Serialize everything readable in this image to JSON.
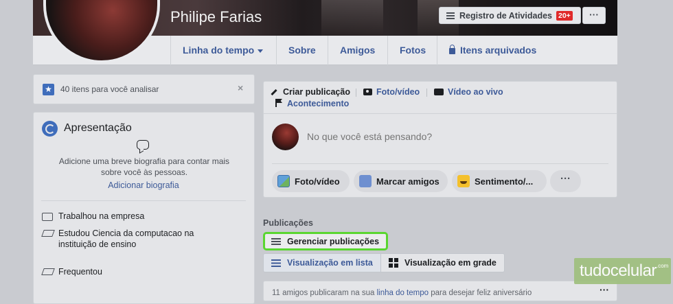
{
  "profile": {
    "name": "Philipe Farias",
    "activity_label": "Registro de Atividades",
    "activity_badge": "20+",
    "more_label": "···"
  },
  "nav": {
    "timeline": "Linha do tempo",
    "about": "Sobre",
    "friends": "Amigos",
    "photos": "Fotos",
    "archived": "Itens arquivados"
  },
  "notice": {
    "text": "40 itens para você analisar",
    "close": "×"
  },
  "intro": {
    "title": "Apresentação",
    "bio_prompt": "Adicione uma breve biografia para contar mais sobre você às pessoas.",
    "bio_link": "Adicionar biografia",
    "items": [
      "Trabalhou na empresa",
      "Estudou Ciencia da computacao na instituição de ensino",
      "Frequentou"
    ]
  },
  "composer": {
    "tabs": {
      "create": "Criar publicação",
      "photo_video": "Foto/vídeo",
      "live": "Vídeo ao vivo",
      "event": "Acontecimento"
    },
    "placeholder": "No que você está pensando?",
    "actions": {
      "photo": "Foto/vídeo",
      "tag": "Marcar amigos",
      "feeling": "Sentimento/...",
      "more": "···"
    }
  },
  "posts": {
    "label": "Publicações",
    "manage": "Gerenciar publicações",
    "list_view": "Visualização em lista",
    "grid_view": "Visualização em grade"
  },
  "feed": {
    "text_before": "11 amigos publicaram na sua ",
    "link": "linha do tempo",
    "text_after": " para desejar feliz aniversário",
    "more": "···"
  },
  "watermark": {
    "brand": "tudocelular",
    "domain": ".com"
  },
  "colors": {
    "accent": "#3d5a98",
    "highlight": "#5ad630",
    "badge": "#e02a2a"
  }
}
